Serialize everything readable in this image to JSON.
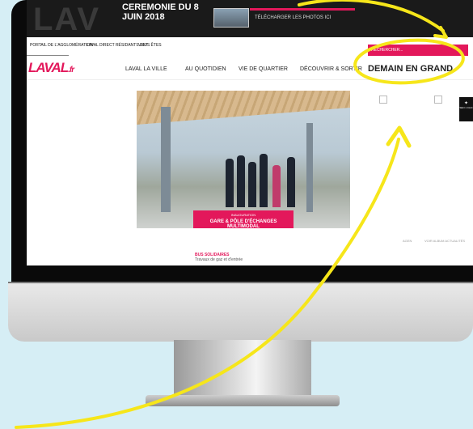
{
  "banner": {
    "ghost_text": "LAV",
    "ceremony_line1": "CEREMONIE DU 8",
    "ceremony_line2": "JUIN 2018",
    "download_label": "TÉLÉCHARGER LES PHOTOS ICI",
    "search_label": "RECHERCHER..."
  },
  "util_nav": {
    "items": [
      "PORTAIL DE L'AGGLOMÉRATION",
      "LAVAL DIRECT RÉSIDANTS 24/7",
      "VOUS ÊTES"
    ]
  },
  "logo": {
    "text": "LAVAL",
    "suffix": ".fr"
  },
  "main_nav": {
    "items": [
      "LAVAL LA VILLE",
      "AU QUOTIDIEN",
      "VIE DE QUARTIER",
      "DÉCOUVRIR & SORTIR"
    ],
    "highlight": "DEMAIN EN GRAND"
  },
  "hero": {
    "kicker": "INAUGURATION",
    "title": "GARE & PÔLE D'ÉCHANGES MULTIMODAL"
  },
  "share": {
    "label": "SEN 1 CLIC"
  },
  "small_links": [
    "AGEN",
    "VOIR ALBUM ACTUALITÉS"
  ],
  "news": {
    "title": "BUS SOLIDAIRES",
    "subtitle": "Travaux de gaz et d'entrée"
  },
  "colors": {
    "brand": "#e3185b",
    "annotation": "#f6e61a",
    "background": "#d6eef5"
  }
}
